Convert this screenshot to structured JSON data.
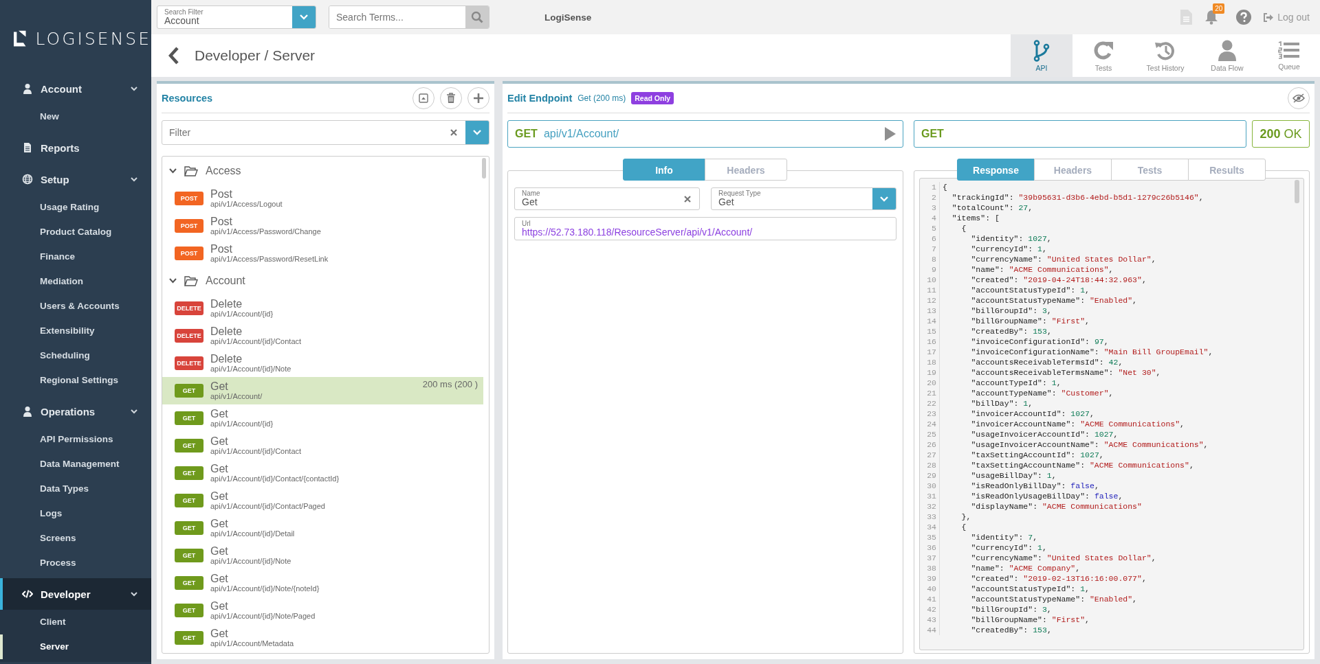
{
  "topbar": {
    "search_filter": {
      "label": "Search Filter",
      "value": "Account"
    },
    "search": {
      "placeholder": "Search Terms..."
    },
    "brand": "LogiSense",
    "notifications": "20",
    "logout": "Log out"
  },
  "sidebar": {
    "logo": "LOGISENSE",
    "groups": [
      {
        "label": "Account",
        "expanded": true,
        "selected": false,
        "children": [
          {
            "label": "New",
            "selected": false
          }
        ]
      },
      {
        "label": "Reports",
        "selected": false
      },
      {
        "label": "Setup",
        "expanded": true,
        "selected": false,
        "children": [
          {
            "label": "Usage Rating",
            "selected": false
          },
          {
            "label": "Product Catalog",
            "selected": false
          },
          {
            "label": "Finance",
            "selected": false
          },
          {
            "label": "Mediation",
            "selected": false
          },
          {
            "label": "Users & Accounts",
            "selected": false
          },
          {
            "label": "Extensibility",
            "selected": false
          },
          {
            "label": "Scheduling",
            "selected": false
          },
          {
            "label": "Regional Settings",
            "selected": false
          }
        ]
      },
      {
        "label": "Operations",
        "expanded": true,
        "selected": false,
        "children": [
          {
            "label": "API Permissions",
            "selected": false
          },
          {
            "label": "Data Management",
            "selected": false
          },
          {
            "label": "Data Types",
            "selected": false
          },
          {
            "label": "Logs",
            "selected": false
          },
          {
            "label": "Screens",
            "selected": false
          },
          {
            "label": "Process",
            "selected": false
          }
        ]
      },
      {
        "label": "Developer",
        "expanded": true,
        "selected": true,
        "children": [
          {
            "label": "Client",
            "selected": false
          },
          {
            "label": "Server",
            "selected": true
          }
        ]
      }
    ]
  },
  "header": {
    "title": "Developer / Server",
    "tabs": [
      {
        "label": "API",
        "selected": true
      },
      {
        "label": "Tests",
        "selected": false
      },
      {
        "label": "Test History",
        "selected": false
      },
      {
        "label": "Data Flow",
        "selected": false
      },
      {
        "label": "Queue",
        "selected": false
      }
    ]
  },
  "resources": {
    "title": "Resources",
    "filter": {
      "placeholder": "Filter"
    },
    "tree": [
      {
        "label": "Access",
        "expanded": true,
        "children": [
          {
            "kind": "post",
            "method": "POST",
            "name": "Post",
            "path": "api/v1/Access/Logout",
            "selected": false
          },
          {
            "kind": "post",
            "method": "POST",
            "name": "Post",
            "path": "api/v1/Access/Password/Change",
            "selected": false
          },
          {
            "kind": "post",
            "method": "POST",
            "name": "Post",
            "path": "api/v1/Access/Password/ResetLink",
            "selected": false
          }
        ]
      },
      {
        "label": "Account",
        "expanded": true,
        "children": [
          {
            "kind": "delete",
            "method": "DELETE",
            "name": "Delete",
            "path": "api/v1/Account/{id}",
            "selected": false
          },
          {
            "kind": "delete",
            "method": "DELETE",
            "name": "Delete",
            "path": "api/v1/Account/{id}/Contact",
            "selected": false
          },
          {
            "kind": "delete",
            "method": "DELETE",
            "name": "Delete",
            "path": "api/v1/Account/{id}/Note",
            "selected": false
          },
          {
            "kind": "get",
            "method": "GET",
            "name": "Get",
            "path": "api/v1/Account/",
            "selected": true,
            "timing": "200 ms (200 )"
          },
          {
            "kind": "get",
            "method": "GET",
            "name": "Get",
            "path": "api/v1/Account/{id}",
            "selected": false
          },
          {
            "kind": "get",
            "method": "GET",
            "name": "Get",
            "path": "api/v1/Account/{id}/Contact",
            "selected": false
          },
          {
            "kind": "get",
            "method": "GET",
            "name": "Get",
            "path": "api/v1/Account/{id}/Contact/{contactId}",
            "selected": false
          },
          {
            "kind": "get",
            "method": "GET",
            "name": "Get",
            "path": "api/v1/Account/{id}/Contact/Paged",
            "selected": false
          },
          {
            "kind": "get",
            "method": "GET",
            "name": "Get",
            "path": "api/v1/Account/{id}/Detail",
            "selected": false
          },
          {
            "kind": "get",
            "method": "GET",
            "name": "Get",
            "path": "api/v1/Account/{id}/Note",
            "selected": false
          },
          {
            "kind": "get",
            "method": "GET",
            "name": "Get",
            "path": "api/v1/Account/{id}/Note/{noteId}",
            "selected": false
          },
          {
            "kind": "get",
            "method": "GET",
            "name": "Get",
            "path": "api/v1/Account/{id}/Note/Paged",
            "selected": false
          },
          {
            "kind": "get",
            "method": "GET",
            "name": "Get",
            "path": "api/v1/Account/Metadata",
            "selected": false
          }
        ]
      }
    ]
  },
  "edit": {
    "title": "Edit Endpoint",
    "subtitle": "Get (200 ms)",
    "badge": "Read Only",
    "request": {
      "method": "GET",
      "path": "api/v1/Account/"
    },
    "response_method": "GET",
    "status": {
      "code": "200",
      "text": "OK"
    },
    "request_tabs": [
      {
        "label": "Info",
        "selected": true
      },
      {
        "label": "Headers",
        "selected": false
      }
    ],
    "fields": {
      "name": {
        "label": "Name",
        "value": "Get"
      },
      "request_type": {
        "label": "Request Type",
        "value": "Get"
      },
      "url": {
        "label": "Url",
        "value": "https://52.73.180.118/ResourceServer/api/v1/Account/"
      }
    },
    "response_tabs": [
      {
        "label": "Response",
        "selected": true
      },
      {
        "label": "Headers",
        "selected": false
      },
      {
        "label": "Tests",
        "selected": false
      },
      {
        "label": "Results",
        "selected": false
      }
    ],
    "code_lines": [
      {
        "n": "1",
        "code": "{"
      },
      {
        "n": "2",
        "code": "  \"trackingId\": \"39b95631-d3b6-4ebd-b5d1-1279c26b5146\","
      },
      {
        "n": "3",
        "code": "  \"totalCount\": 27,"
      },
      {
        "n": "4",
        "code": "  \"items\": ["
      },
      {
        "n": "5",
        "code": "    {"
      },
      {
        "n": "6",
        "code": "      \"identity\": 1027,"
      },
      {
        "n": "7",
        "code": "      \"currencyId\": 1,"
      },
      {
        "n": "8",
        "code": "      \"currencyName\": \"United States Dollar\","
      },
      {
        "n": "9",
        "code": "      \"name\": \"ACME Communications\","
      },
      {
        "n": "10",
        "code": "      \"created\": \"2019-04-24T18:44:32.963\","
      },
      {
        "n": "11",
        "code": "      \"accountStatusTypeId\": 1,"
      },
      {
        "n": "12",
        "code": "      \"accountStatusTypeName\": \"Enabled\","
      },
      {
        "n": "13",
        "code": "      \"billGroupId\": 3,"
      },
      {
        "n": "14",
        "code": "      \"billGroupName\": \"First\","
      },
      {
        "n": "15",
        "code": "      \"createdBy\": 153,"
      },
      {
        "n": "16",
        "code": "      \"invoiceConfigurationId\": 97,"
      },
      {
        "n": "17",
        "code": "      \"invoiceConfigurationName\": \"Main Bill GroupEmail\","
      },
      {
        "n": "18",
        "code": "      \"accountsReceivableTermsId\": 42,"
      },
      {
        "n": "19",
        "code": "      \"accountsReceivableTermsName\": \"Net 30\","
      },
      {
        "n": "20",
        "code": "      \"accountTypeId\": 1,"
      },
      {
        "n": "21",
        "code": "      \"accountTypeName\": \"Customer\","
      },
      {
        "n": "22",
        "code": "      \"billDay\": 1,"
      },
      {
        "n": "23",
        "code": "      \"invoicerAccountId\": 1027,"
      },
      {
        "n": "24",
        "code": "      \"invoicerAccountName\": \"ACME Communications\","
      },
      {
        "n": "25",
        "code": "      \"usageInvoicerAccountId\": 1027,"
      },
      {
        "n": "26",
        "code": "      \"usageInvoicerAccountName\": \"ACME Communications\","
      },
      {
        "n": "27",
        "code": "      \"taxSettingAccountId\": 1027,"
      },
      {
        "n": "28",
        "code": "      \"taxSettingAccountName\": \"ACME Communications\","
      },
      {
        "n": "29",
        "code": "      \"usageBillDay\": 1,"
      },
      {
        "n": "30",
        "code": "      \"isReadOnlyBillDay\": false,"
      },
      {
        "n": "31",
        "code": "      \"isReadOnlyUsageBillDay\": false,"
      },
      {
        "n": "32",
        "code": "      \"displayName\": \"ACME Communications\""
      },
      {
        "n": "33",
        "code": "    },"
      },
      {
        "n": "34",
        "code": "    {"
      },
      {
        "n": "35",
        "code": "      \"identity\": 7,"
      },
      {
        "n": "36",
        "code": "      \"currencyId\": 1,"
      },
      {
        "n": "37",
        "code": "      \"currencyName\": \"United States Dollar\","
      },
      {
        "n": "38",
        "code": "      \"name\": \"ACME Company\","
      },
      {
        "n": "39",
        "code": "      \"created\": \"2019-02-13T16:16:00.077\","
      },
      {
        "n": "40",
        "code": "      \"accountStatusTypeId\": 1,"
      },
      {
        "n": "41",
        "code": "      \"accountStatusTypeName\": \"Enabled\","
      },
      {
        "n": "42",
        "code": "      \"billGroupId\": 3,"
      },
      {
        "n": "43",
        "code": "      \"billGroupName\": \"First\","
      },
      {
        "n": "44",
        "code": "      \"createdBy\": 153,"
      }
    ]
  }
}
